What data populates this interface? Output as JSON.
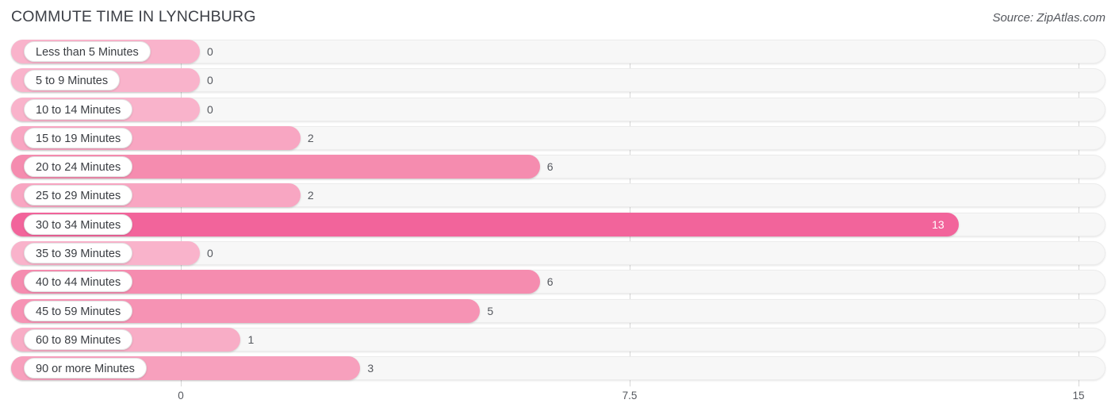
{
  "header": {
    "title": "COMMUTE TIME IN LYNCHBURG",
    "source": "Source: ZipAtlas.com"
  },
  "colors": {
    "bar_min": "#f9b3cb",
    "bar_mid": "#f589ad",
    "bar_max": "#f2649b",
    "track": "#f7f7f7",
    "gridline": "#d8d8d8",
    "text": "#55585e",
    "title": "#3c3f46"
  },
  "chart_data": {
    "type": "bar",
    "orientation": "horizontal",
    "title": "COMMUTE TIME IN LYNCHBURG",
    "xlabel": "",
    "ylabel": "",
    "xlim": [
      0,
      15
    ],
    "xticks": [
      "0",
      "7.5",
      "15"
    ],
    "xtick_values": [
      0,
      7.5,
      15
    ],
    "grid": true,
    "legend": false,
    "categories": [
      "Less than 5 Minutes",
      "5 to 9 Minutes",
      "10 to 14 Minutes",
      "15 to 19 Minutes",
      "20 to 24 Minutes",
      "25 to 29 Minutes",
      "30 to 34 Minutes",
      "35 to 39 Minutes",
      "40 to 44 Minutes",
      "45 to 59 Minutes",
      "60 to 89 Minutes",
      "90 or more Minutes"
    ],
    "values": [
      0,
      0,
      0,
      2,
      6,
      2,
      13,
      0,
      6,
      5,
      1,
      3
    ],
    "value_labels": [
      "0",
      "0",
      "0",
      "2",
      "6",
      "2",
      "13",
      "0",
      "6",
      "5",
      "1",
      "3"
    ]
  }
}
